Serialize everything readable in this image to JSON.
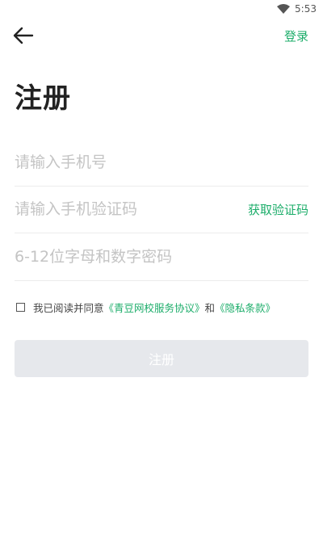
{
  "status_bar": {
    "time": "5:53",
    "wifi_icon": "wifi-icon"
  },
  "nav": {
    "back_icon": "back-arrow-icon",
    "login_label": "登录"
  },
  "page_title": "注册",
  "form": {
    "phone_placeholder": "请输入手机号",
    "code_placeholder": "请输入手机验证码",
    "get_code_label": "获取验证码",
    "password_placeholder": "6-12位字母和数字密码"
  },
  "agreement": {
    "prefix": "我已阅读并同意",
    "service_link": "《青豆网校服务协议》",
    "and": "和",
    "privacy_link": "《隐私条款》"
  },
  "register_button": {
    "label": "注册"
  },
  "colors": {
    "accent": "#1cad6a",
    "button_disabled": "#e6e8ec"
  }
}
